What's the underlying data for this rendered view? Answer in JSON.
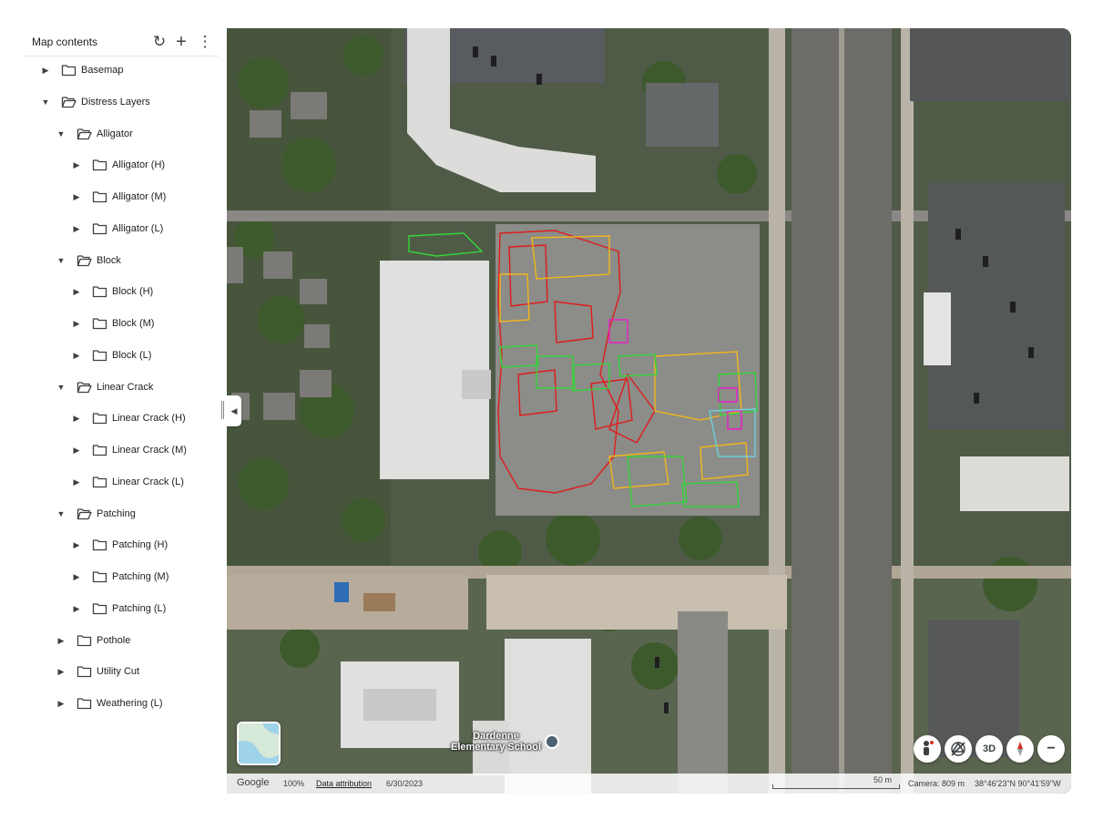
{
  "panel": {
    "title": "Map contents",
    "refresh_icon": "refresh-icon",
    "add_icon": "add-icon",
    "more_icon": "more-vert-icon"
  },
  "tree": [
    {
      "label": "Basemap",
      "expanded": false
    },
    {
      "label": "Distress Layers",
      "expanded": true
    },
    {
      "label": "Alligator",
      "expanded": true
    },
    {
      "label": "Alligator (H)",
      "expanded": false
    },
    {
      "label": "Alligator (M)",
      "expanded": false
    },
    {
      "label": "Alligator (L)",
      "expanded": false
    },
    {
      "label": "Block",
      "expanded": true
    },
    {
      "label": "Block (H)",
      "expanded": false
    },
    {
      "label": "Block (M)",
      "expanded": false
    },
    {
      "label": "Block (L)",
      "expanded": false
    },
    {
      "label": "Linear Crack",
      "expanded": true
    },
    {
      "label": "Linear Crack (H)",
      "expanded": false
    },
    {
      "label": "Linear Crack (M)",
      "expanded": false
    },
    {
      "label": "Linear Crack (L)",
      "expanded": false
    },
    {
      "label": "Patching",
      "expanded": true
    },
    {
      "label": "Patching (H)",
      "expanded": false
    },
    {
      "label": "Patching (M)",
      "expanded": false
    },
    {
      "label": "Patching (L)",
      "expanded": false
    },
    {
      "label": "Pothole",
      "expanded": false
    },
    {
      "label": "Utility Cut",
      "expanded": false
    },
    {
      "label": "Weathering (L)",
      "expanded": false
    }
  ],
  "map": {
    "place_label_line1": "Dardenne",
    "place_label_line2": "Elementary School",
    "controls": {
      "pegman_icon": "pegman-icon",
      "tilt_icon": "tilt-off-icon",
      "view_3d": "3D",
      "compass_icon": "compass-icon",
      "zoom_out": "−"
    },
    "distress_colors": {
      "high": "#e01b1b",
      "medium": "#f2b61a",
      "low": "#35d43a",
      "other": "#e81ec8"
    }
  },
  "status": {
    "brand": "Google",
    "zoom": "100%",
    "attribution": "Data attribution",
    "date": "6/30/2023",
    "scale": "50 m",
    "camera": "Camera: 809 m",
    "coords": "38°46'23\"N 90°41'59\"W"
  }
}
